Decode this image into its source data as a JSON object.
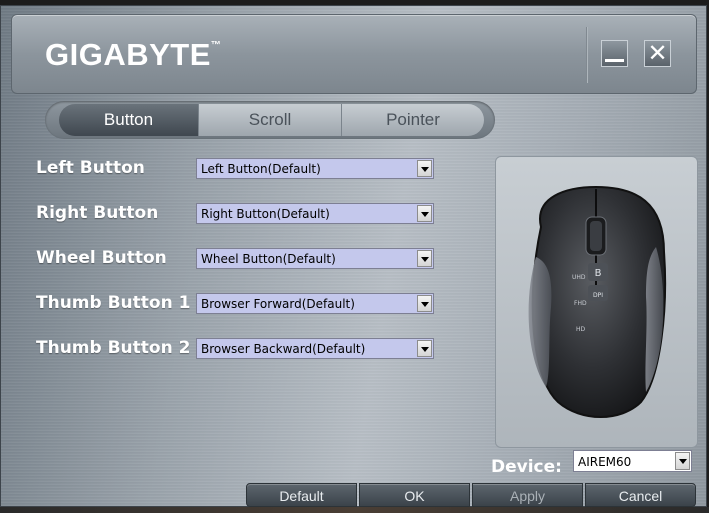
{
  "header": {
    "logo_text": "GIGABYTE",
    "logo_mark": "™",
    "minimize_icon": "minimize-icon",
    "close_icon": "close-icon",
    "close_glyph": "✕"
  },
  "tabs": [
    {
      "label": "Button",
      "active": true
    },
    {
      "label": "Scroll",
      "active": false
    },
    {
      "label": "Pointer",
      "active": false
    }
  ],
  "buttons": [
    {
      "label": "Left Button",
      "value": "Left Button(Default)"
    },
    {
      "label": "Right Button",
      "value": "Right Button(Default)"
    },
    {
      "label": "Wheel Button",
      "value": "Wheel Button(Default)"
    },
    {
      "label": "Thumb Button 1",
      "value": "Browser Forward(Default)"
    },
    {
      "label": "Thumb Button 2",
      "value": "Browser Backward(Default)"
    }
  ],
  "mouse_image": {
    "side_labels": [
      "UHD",
      "FHD",
      "HD"
    ],
    "button_glyphs": [
      "B",
      "DPI"
    ]
  },
  "device": {
    "label": "Device:",
    "value": "AIREM60"
  },
  "actions": {
    "default_label": "Default",
    "ok_label": "OK",
    "apply_label": "Apply",
    "cancel_label": "Cancel"
  },
  "colors": {
    "select_bg": "#c4c8ec",
    "active_tab": "#3f474f"
  }
}
